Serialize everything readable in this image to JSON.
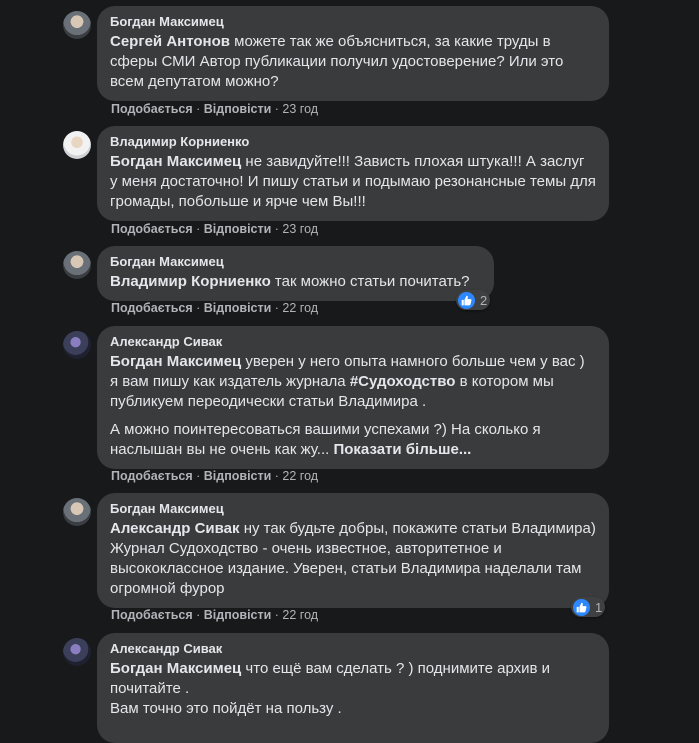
{
  "comments": [
    {
      "author": "Богдан Максимец",
      "mention": "Сергей Антонов",
      "text": " можете так же объясниться, за какие труды в сферы СМИ Автор публикации получил удостоверение? Или это всем депутатом можно?",
      "like": "Подобається",
      "reply": "Відповісти",
      "time": "23 год"
    },
    {
      "author": "Владимир Корниенко",
      "mention": "Богдан Максимец",
      "text": " не завидуйте!!! Зависть плохая штука!!! А заслуг у меня достаточно! И пишу статьи и подымаю резонансные темы для громады, побольше и ярче чем Вы!!!",
      "like": "Подобається",
      "reply": "Відповісти",
      "time": "23 год"
    },
    {
      "author": "Богдан Максимец",
      "mention": "Владимир Корниенко",
      "text": " так можно статьи почитать?",
      "like": "Подобається",
      "reply": "Відповісти",
      "time": "22 год",
      "reactions": "2"
    },
    {
      "author": "Александр Сивак",
      "mention": "Богдан Максимец",
      "text_a": " уверен у него опыта намного больше чем у вас ) я вам пишу как издатель журнала ",
      "hashtag": "#Судоходство",
      "text_b": " в котором мы публикуем переодически статьи Владимира .",
      "para2": "А можно поинтересоваться вашими успехами ?) На сколько я наслышан вы не очень как жу... ",
      "see_more": "Показати більше...",
      "like": "Подобається",
      "reply": "Відповісти",
      "time": "22 год"
    },
    {
      "author": "Богдан Максимец",
      "mention": "Александр Сивак",
      "text": " ну так будьте добры, покажите статьи Владимира) Журнал Судоходство - очень известное, авторитетное и высококлассное издание. Уверен, статьи Владимира наделали там огромной фурор",
      "like": "Подобається",
      "reply": "Відповісти",
      "time": "22 год",
      "reactions": "1"
    },
    {
      "author": "Александр Сивак",
      "mention": "Богдан Максимец",
      "text": " что ещё вам сделать ? ) поднимите архив и почитайте .",
      "line2": "Вам точно это пойдёт на пользу ."
    }
  ],
  "separator": " · ",
  "icons": {
    "reaction": "like-icon"
  },
  "colors": {
    "bubble": "#3a3b3c",
    "background": "#18191a",
    "like_blue": "#2d88ff"
  }
}
